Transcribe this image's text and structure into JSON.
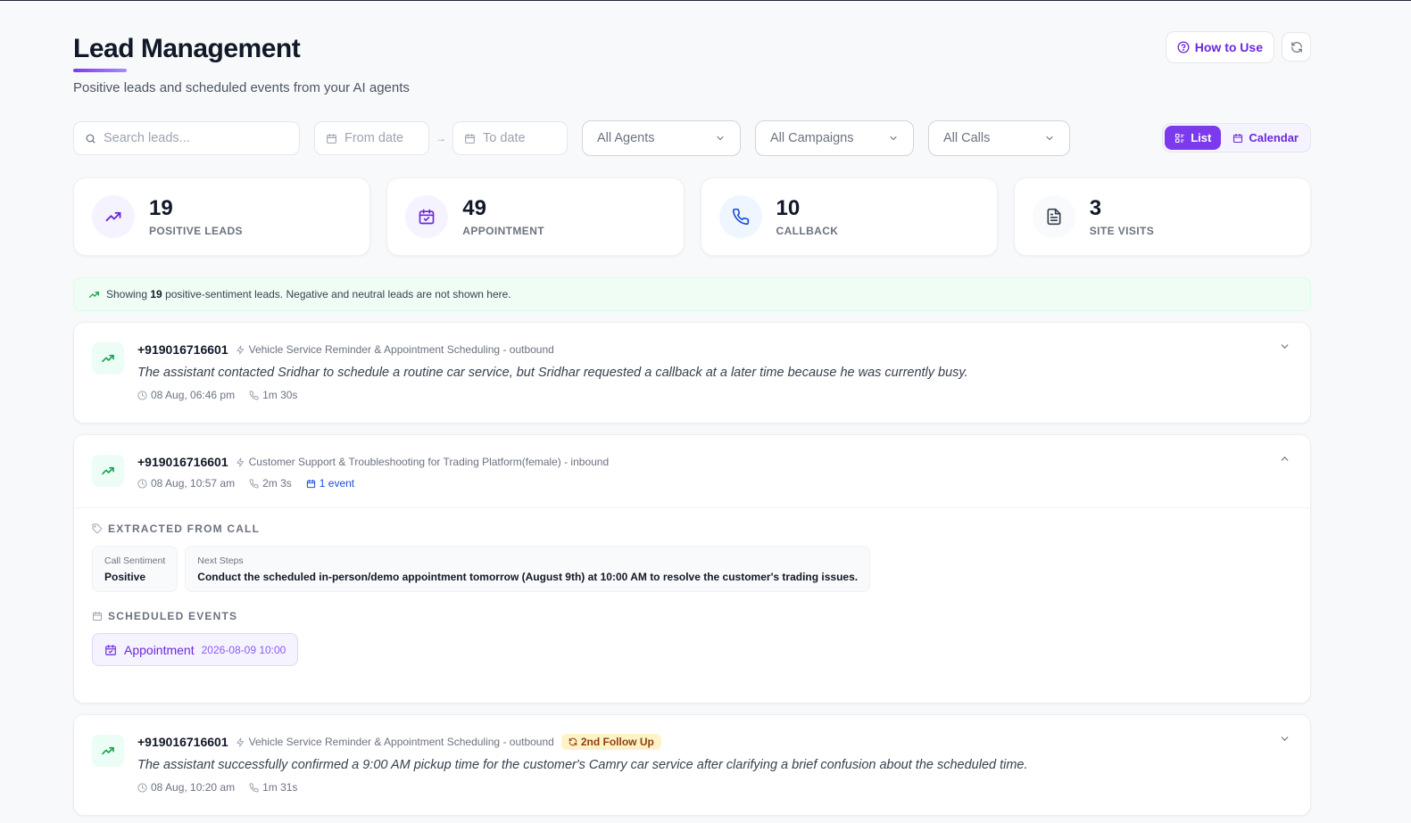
{
  "header": {
    "title": "Lead Management",
    "subtitle": "Positive leads and scheduled events from your AI agents",
    "how_to_use_label": "How to Use"
  },
  "filters": {
    "search_placeholder": "Search leads...",
    "from_placeholder": "From date",
    "to_placeholder": "To date",
    "arrow": "→",
    "agents": "All Agents",
    "campaigns": "All Campaigns",
    "calls": "All Calls",
    "view_list": "List",
    "view_calendar": "Calendar",
    "active_view": "List"
  },
  "stats": [
    {
      "value": "19",
      "label": "POSITIVE LEADS",
      "icon": "trending-up-icon",
      "color": "#6d28d9"
    },
    {
      "value": "49",
      "label": "APPOINTMENT",
      "icon": "calendar-check-icon",
      "color": "#6d28d9"
    },
    {
      "value": "10",
      "label": "CALLBACK",
      "icon": "phone-icon",
      "color": "#1d4ed8"
    },
    {
      "value": "3",
      "label": "SITE VISITS",
      "icon": "document-icon",
      "color": "#374151"
    }
  ],
  "banner": {
    "prefix": "Showing",
    "count": "19",
    "suffix": "positive-sentiment leads. Negative and neutral leads are not shown here."
  },
  "leads": [
    {
      "phone": "+919016716601",
      "campaign": "Vehicle Service Reminder & Appointment Scheduling - outbound",
      "summary": "The assistant contacted Sridhar to schedule a routine car service, but Sridhar requested a callback at a later time because he was currently busy.",
      "time": "08 Aug, 06:46 pm",
      "duration": "1m 30s",
      "expanded": false
    },
    {
      "phone": "+919016716601",
      "campaign": "Customer Support & Troubleshooting for Trading Platform(female) - inbound",
      "time": "08 Aug, 10:57 am",
      "duration": "2m 3s",
      "events_count": "1 event",
      "expanded": true,
      "extracted_title": "EXTRACTED FROM CALL",
      "extracted": [
        {
          "key": "Call Sentiment",
          "value": "Positive"
        },
        {
          "key": "Next Steps",
          "value": "Conduct the scheduled in-person/demo appointment tomorrow (August 9th) at 10:00 AM to resolve the customer's trading issues."
        }
      ],
      "events_title": "SCHEDULED EVENTS",
      "events": [
        {
          "name": "Appointment",
          "datetime": "2026-08-09 10:00"
        }
      ]
    },
    {
      "phone": "+919016716601",
      "campaign": "Vehicle Service Reminder & Appointment Scheduling - outbound",
      "badge": "2nd Follow Up",
      "summary": "The assistant successfully confirmed a 9:00 AM pickup time for the customer's Camry car service after clarifying a brief confusion about the scheduled time.",
      "time": "08 Aug, 10:20 am",
      "duration": "1m 31s",
      "expanded": false
    }
  ]
}
